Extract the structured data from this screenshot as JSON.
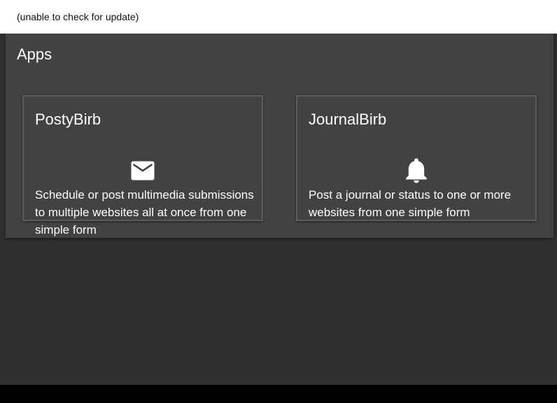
{
  "header": {
    "update_status": "(unable to check for update)"
  },
  "apps": {
    "title": "Apps",
    "cards": [
      {
        "name": "PostyBirb",
        "icon": "mail-icon",
        "description": "Schedule or post multimedia submissions to multiple websites all at once from one simple form"
      },
      {
        "name": "JournalBirb",
        "icon": "bell-icon",
        "description": "Post a journal or status to one or more websites from one simple form"
      }
    ]
  },
  "colors": {
    "background": "#303030",
    "panel": "#424242",
    "card_border": "#5c5c5c",
    "topbar": "#ffffff"
  }
}
